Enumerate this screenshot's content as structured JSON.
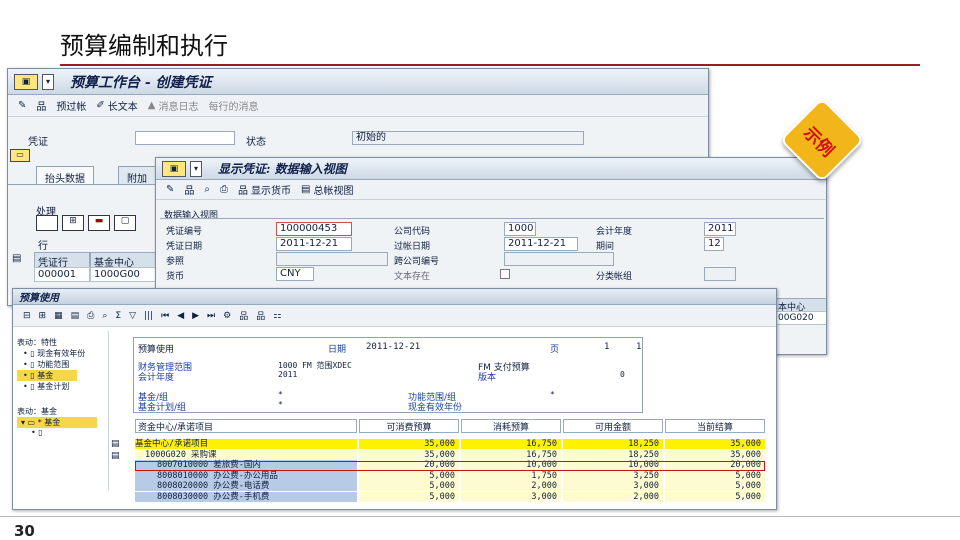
{
  "slide": {
    "title": "预算编制和执行",
    "page_number": "30",
    "badge": "示例"
  },
  "w1": {
    "title": "预算工作台 - 创建凭证",
    "toolbar": {
      "post": "预过帐",
      "long_text": "长文本",
      "msg_log": "消息日志",
      "row_msg": "每行的消息"
    },
    "voucher_label": "凭证",
    "voucher_value": "",
    "status_label": "状态",
    "status_value": "初始的",
    "tabs": [
      "抬头数据",
      "附加"
    ],
    "section": "处理",
    "row_label": "行",
    "grid_headers": [
      "凭证行",
      "基金中心"
    ],
    "grid_rows": [
      [
        "000001",
        "1000G00"
      ]
    ]
  },
  "w2": {
    "title": "显示凭证: 数据输入视图",
    "toolbar": {
      "show_currency": "显示货币",
      "ledger_view": "总帐视图"
    },
    "group": "数据输入视图",
    "fields": {
      "doc_no_label": "凭证编号",
      "doc_no": "100000453",
      "cocode_label": "公司代码",
      "cocode": "1000",
      "fiscal_year_label": "会计年度",
      "fiscal_year": "2011",
      "doc_date_label": "凭证日期",
      "doc_date": "2011-12-21",
      "post_date_label": "过帐日期",
      "post_date": "2011-12-21",
      "period_label": "期间",
      "period": "12",
      "ref_label": "参照",
      "cross_label": "跨公司编号",
      "currency_label": "货币",
      "currency": "CNY",
      "text_exists_label": "文本存在",
      "ledger_group_label": "分类帐组"
    },
    "right_edge": {
      "hdr": "本中心",
      "cell": "00G020"
    }
  },
  "w3": {
    "title": "预算使用",
    "left_tree": {
      "header1": "表动：特性",
      "items1": [
        "现金有效年份",
        "功能范围",
        "基金",
        "基金计划"
      ],
      "header2": "表动：基金",
      "items2": [
        "* 基金"
      ]
    },
    "report": {
      "title": "预算使用",
      "date_label": "日期",
      "date": "2011-12-21",
      "page_label": "页",
      "page": "1",
      "page_total": "1",
      "fm_area_label": "财务管理范围",
      "fm_area_value": "1000 FM 范围XDEC",
      "fm_pay_label": "FM 支付预算",
      "fiscal_year_label": "会计年度",
      "fiscal_year": "2011",
      "version_label": "版本",
      "version": "0",
      "fund_group_label": "基金/组",
      "fund_group": "*",
      "fund_plan_label": "基金计划/组",
      "fund_plan": "*",
      "func_area_label": "功能范围/组",
      "func_area": "*",
      "cash_year_label": "现金有效年份",
      "columns": [
        "资金中心/承诺项目",
        "可消费预算",
        "消耗预算",
        "可用金额",
        "当前结算"
      ],
      "rows": [
        {
          "item": "基金中心/承诺项目",
          "a": "35,000",
          "b": "16,750",
          "c": "18,250",
          "d": "35,000",
          "style": "total"
        },
        {
          "item": "1000G020  采购课",
          "a": "35,000",
          "b": "16,750",
          "c": "18,250",
          "d": "35,000",
          "style": "sub"
        },
        {
          "item": "8007010000  差旅费-国内",
          "a": "20,000",
          "b": "10,000",
          "c": "10,000",
          "d": "20,000",
          "style": "highlight"
        },
        {
          "item": "8008010000  办公费-办公用品",
          "a": "5,000",
          "b": "1,750",
          "c": "3,250",
          "d": "5,000",
          "style": "detail"
        },
        {
          "item": "8008020000  办公费-电话费",
          "a": "5,000",
          "b": "2,000",
          "c": "3,000",
          "d": "5,000",
          "style": "detail"
        },
        {
          "item": "8008030000  办公费-手机费",
          "a": "5,000",
          "b": "3,000",
          "c": "2,000",
          "d": "5,000",
          "style": "detail"
        }
      ]
    }
  },
  "colors": {
    "accent_rule": "#9b1c22",
    "badge": "#f2b51a",
    "highlight_border": "#d01010"
  }
}
